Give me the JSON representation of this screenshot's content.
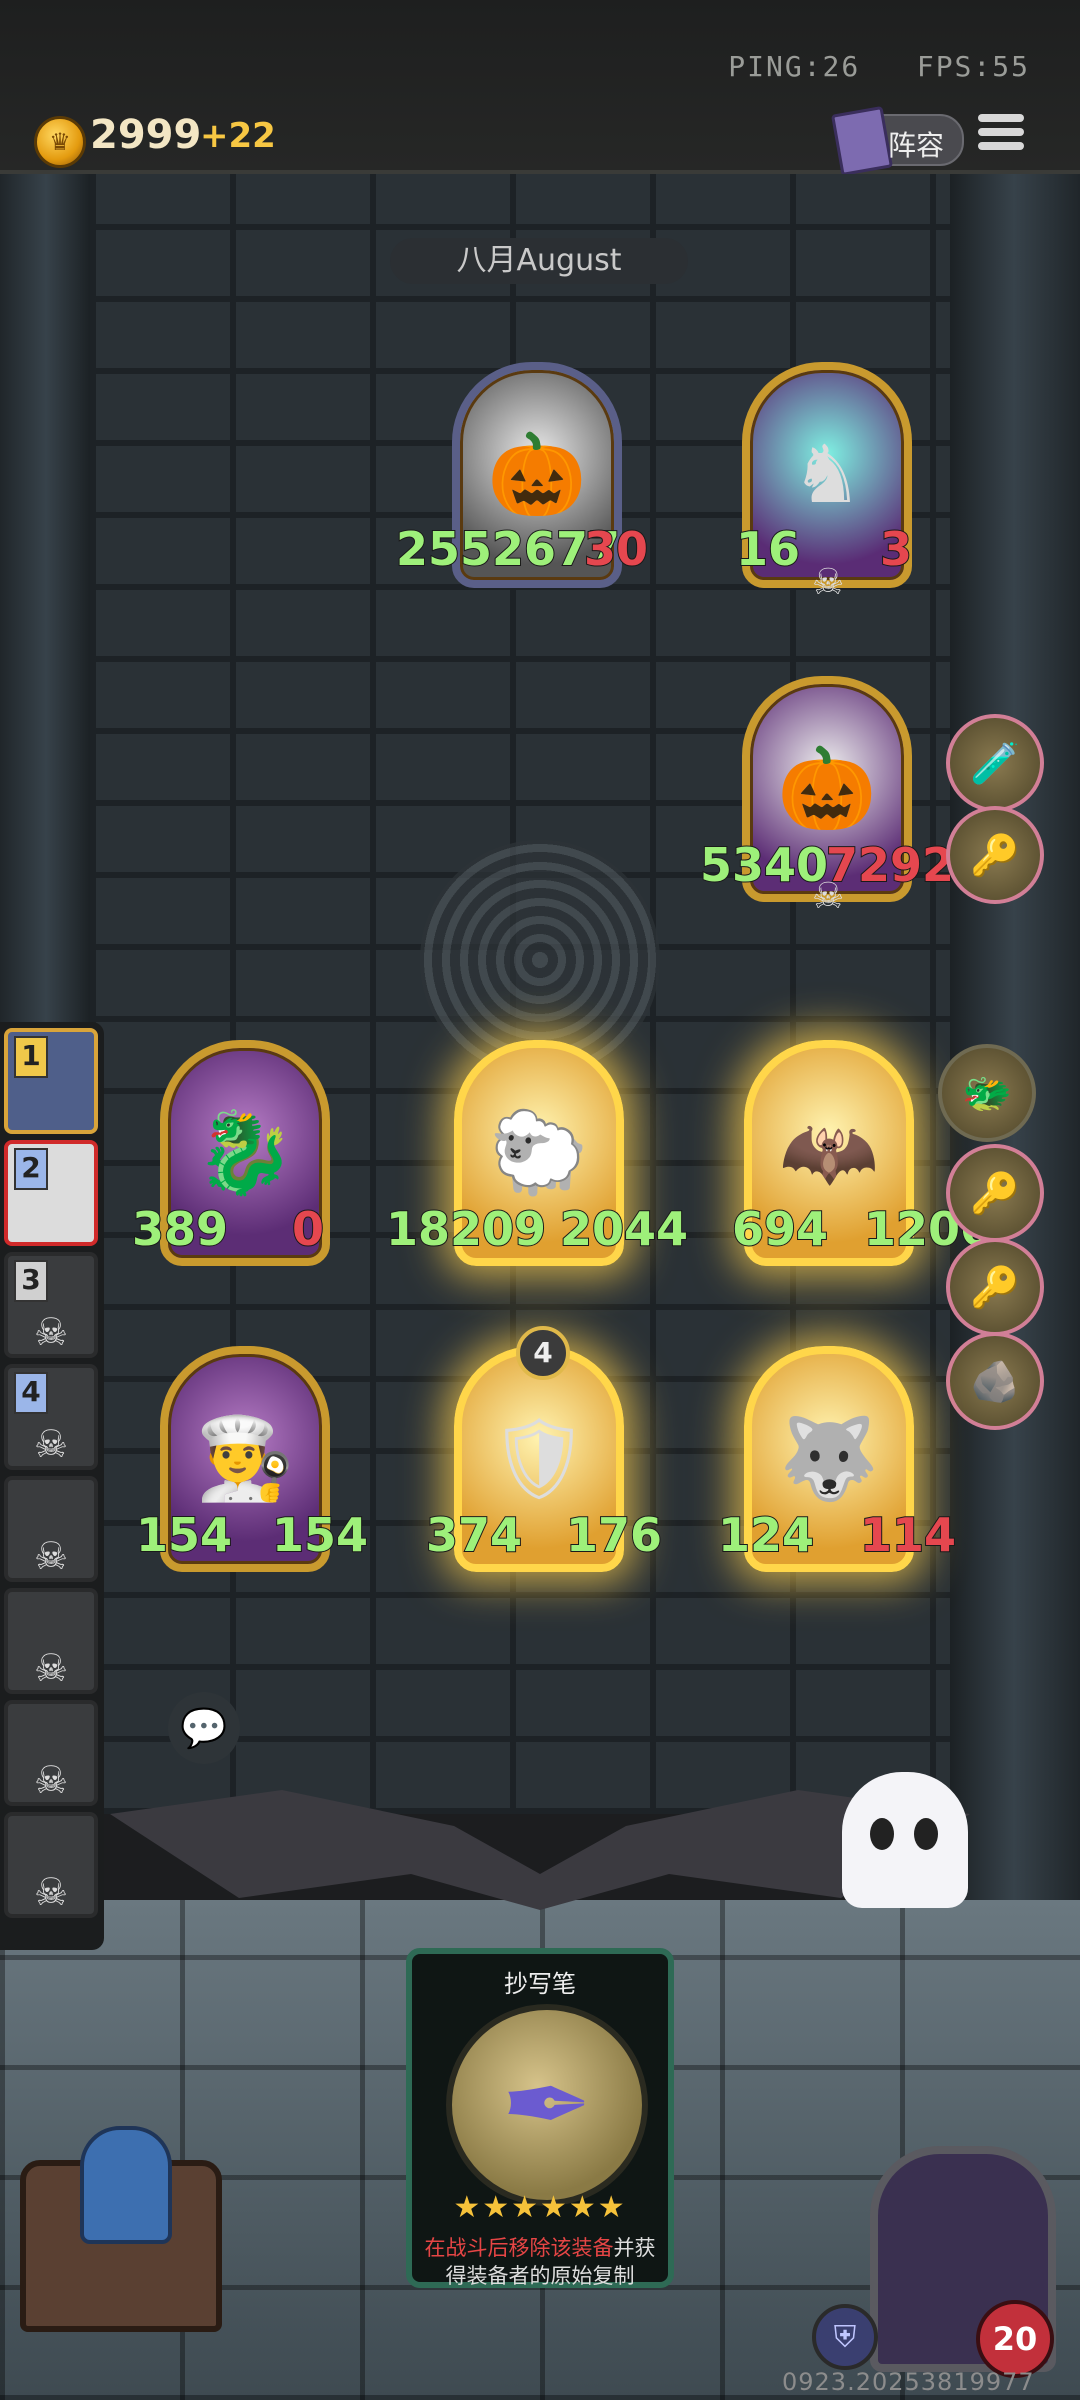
{
  "status": {
    "ping": "PING:26",
    "fps": "FPS:55"
  },
  "resources": {
    "gold": "2999",
    "gold_gain": "+22"
  },
  "header": {
    "lineup_label": "阵容"
  },
  "board": {
    "month": "八月August"
  },
  "enemies": [
    {
      "name": "pumpkin-scarecrow",
      "atk": "2552677",
      "hp": "30"
    },
    {
      "name": "ghost-knight",
      "atk": "16",
      "hp": "3"
    },
    {
      "name": "pumpkin-scarecrow-2",
      "atk": "5340",
      "hp": "7292"
    }
  ],
  "allies": [
    {
      "name": "dragon-unit",
      "atk": "389",
      "hp": "0"
    },
    {
      "name": "sheep-unit",
      "atk": "18209",
      "hp": "2044"
    },
    {
      "name": "bat-witch-unit",
      "atk": "694",
      "hp": "1206"
    },
    {
      "name": "chef-unit",
      "atk": "154",
      "hp": "154"
    },
    {
      "name": "knight-unit",
      "atk": "374",
      "hp": "176",
      "badge": "4"
    },
    {
      "name": "wolf-unit",
      "atk": "124",
      "hp": "114"
    }
  ],
  "roster": [
    "1",
    "2",
    "3",
    "4"
  ],
  "card": {
    "title": "抄写笔",
    "stars": "★★★★★★",
    "desc_red": "在战斗后移除该装备",
    "desc_rest": "并获得装备者的原始复制"
  },
  "player": {
    "hp": "20"
  },
  "build": "0923.20253819977",
  "icons": [
    "coin-icon",
    "menu-icon",
    "chat-icon",
    "shield-icon",
    "skull-icon"
  ]
}
